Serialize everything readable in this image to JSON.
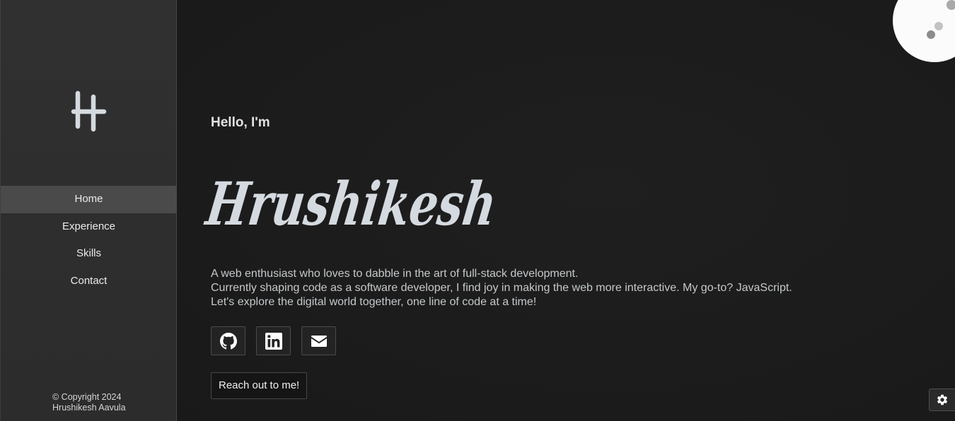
{
  "sidebar": {
    "logo_icon": "h-monogram-logo",
    "nav": [
      {
        "label": "Home",
        "active": true
      },
      {
        "label": "Experience",
        "active": false
      },
      {
        "label": "Skills",
        "active": false
      },
      {
        "label": "Contact",
        "active": false
      }
    ],
    "copyright_line1": "© Copyright 2024",
    "copyright_line2": "Hrushikesh Aavula"
  },
  "hero": {
    "greeting": "Hello, I'm",
    "name": "Hrushikesh",
    "bio": [
      "A web enthusiast who loves to dabble in the art of full-stack development.",
      "Currently shaping code as a software developer, I find joy in making the web more interactive. My go-to? JavaScript.",
      "Let's explore the digital world together, one line of code at a time!"
    ],
    "socials": [
      {
        "icon": "github-icon"
      },
      {
        "icon": "linkedin-icon"
      },
      {
        "icon": "envelope-icon"
      }
    ],
    "cta_label": "Reach out to me!"
  },
  "theme_toggle": {
    "icon": "moon-icon"
  },
  "settings": {
    "icon": "gear-icon"
  },
  "colors": {
    "background": "#1c1c1c",
    "sidebar": "#2f2f2f",
    "active_nav": "#4a4a4a",
    "accent_text": "#d4dadf"
  }
}
